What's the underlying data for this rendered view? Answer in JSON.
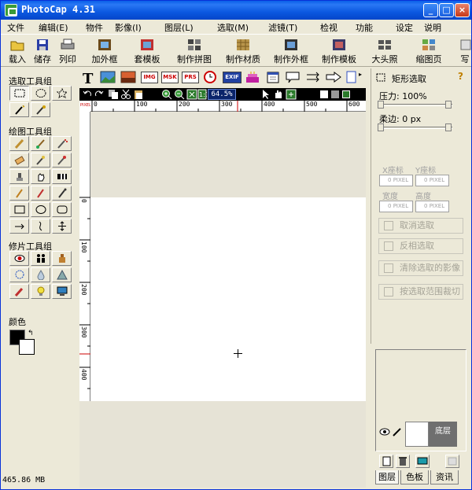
{
  "window": {
    "title": "PhotoCap 4.31"
  },
  "menu": [
    "文件",
    "编辑(E)",
    "物件",
    "影像(I)",
    "图层(L)",
    "选取(M)",
    "滤镜(T)",
    "检视",
    "功能",
    "设定",
    "说明"
  ],
  "toolbar": {
    "items": [
      "载入",
      "储存",
      "列印",
      "加外框",
      "套模板",
      "制作拼图",
      "制作材质",
      "制作外框",
      "制作模板",
      "大头照",
      "缩图页",
      "写"
    ]
  },
  "left_panel": {
    "select_title": "选取工具组",
    "draw_title": "绘图工具组",
    "retouch_title": "修片工具组",
    "color_title": "颜色"
  },
  "draw_bar": {
    "text_tool": "T",
    "badges": [
      "IMG",
      "MSK",
      "PRS",
      "EXIF"
    ]
  },
  "view_bar": {
    "zoom": "64.5%"
  },
  "ruler": {
    "corner": "PIXEL",
    "h_labels": [
      "0",
      "100",
      "200",
      "300",
      "400",
      "500",
      "600"
    ],
    "v_labels": [
      "0",
      "100",
      "200",
      "300",
      "400"
    ]
  },
  "right_panel": {
    "title": "矩形选取",
    "pressure_label": "压力: 100%",
    "feather_label": "柔边: 0 px",
    "x_label": "X座标",
    "y_label": "Y座标",
    "w_label": "宽度",
    "h_label": "高度",
    "x_value": "0",
    "y_value": "0",
    "w_value": "0",
    "h_value": "0",
    "unit": "PIXEL",
    "buttons": [
      "取消选取",
      "反相选取",
      "清除选取的影像",
      "按选取范围裁切"
    ]
  },
  "layers": {
    "layer_name": "底层",
    "tabs": [
      "图层",
      "色板",
      "资讯"
    ]
  },
  "status": {
    "memory": "465.86 MB"
  },
  "colors": {
    "title_bar": "#0a5fe8",
    "foreground": "#000000",
    "background": "#ffffff"
  }
}
